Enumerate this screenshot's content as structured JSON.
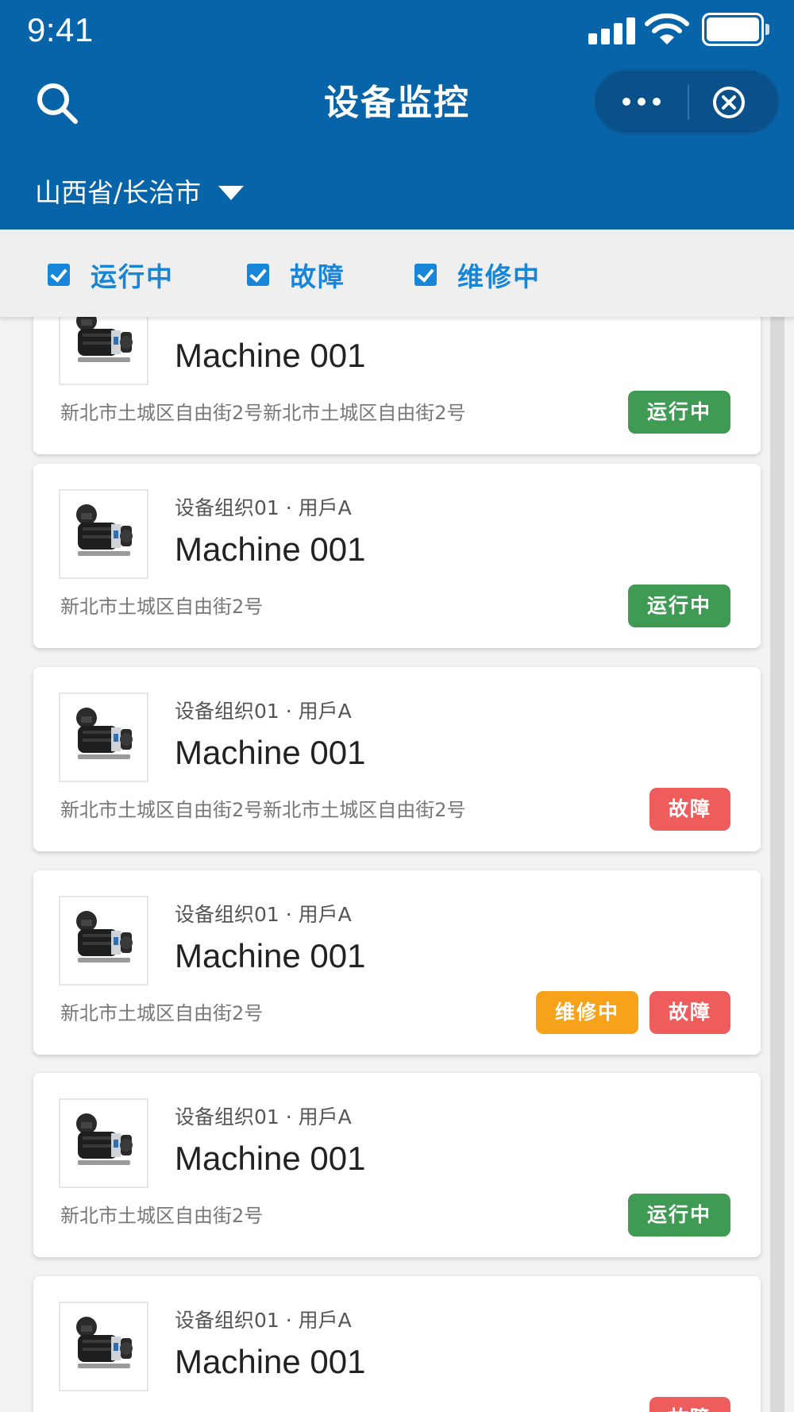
{
  "status_bar": {
    "time": "9:41"
  },
  "header": {
    "title": "设备监控",
    "region": "山西省/长治市"
  },
  "filters": [
    {
      "label": "运行中",
      "checked": true
    },
    {
      "label": "故障",
      "checked": true
    },
    {
      "label": "维修中",
      "checked": true
    }
  ],
  "colors": {
    "header": "#0864a8",
    "running": "#3f9a53",
    "fault": "#ee5c5c",
    "repair": "#f6a21a",
    "filter": "#1785d8"
  },
  "devices": [
    {
      "org": "",
      "name": "Machine 001",
      "address": "新北市土城区自由街2号新北市土城区自由街2号",
      "statuses": [
        "运行中"
      ]
    },
    {
      "org": "设备组织01 · 用戶A",
      "name": "Machine 001",
      "address": "新北市土城区自由街2号",
      "statuses": [
        "运行中"
      ]
    },
    {
      "org": "设备组织01 · 用戶A",
      "name": "Machine 001",
      "address": "新北市土城区自由街2号新北市土城区自由街2号",
      "statuses": [
        "故障"
      ]
    },
    {
      "org": "设备组织01 · 用戶A",
      "name": "Machine 001",
      "address": "新北市土城区自由街2号",
      "statuses": [
        "维修中",
        "故障"
      ]
    },
    {
      "org": "设备组织01 · 用戶A",
      "name": "Machine 001",
      "address": "新北市土城区自由街2号",
      "statuses": [
        "运行中"
      ]
    },
    {
      "org": "设备组织01 · 用戶A",
      "name": "Machine 001",
      "address": "",
      "statuses": [
        "故障"
      ]
    }
  ]
}
